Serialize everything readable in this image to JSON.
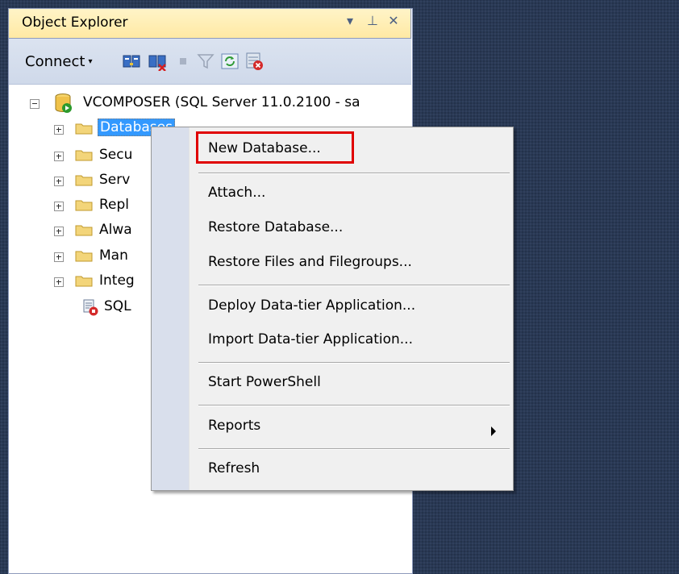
{
  "panel": {
    "title": "Object Explorer",
    "controls": {
      "dropdown": "▾",
      "pin": "⊥",
      "close": "✕"
    }
  },
  "toolbar": {
    "connect_label": "Connect",
    "connect_caret": "▾",
    "icons": [
      "connect-object-explorer-icon",
      "disconnect-icon",
      "stop-icon",
      "filter-icon",
      "refresh-icon",
      "activity-monitor-icon"
    ]
  },
  "tree": {
    "server": {
      "label": "VCOMPOSER (SQL Server 11.0.2100 - sa"
    },
    "children": [
      {
        "label": "Databases",
        "selected": true
      },
      {
        "label": "Secu"
      },
      {
        "label": "Serv"
      },
      {
        "label": "Repl"
      },
      {
        "label": "Alwa"
      },
      {
        "label": "Man"
      },
      {
        "label": "Integ"
      },
      {
        "label": "SQL"
      }
    ]
  },
  "context_menu": {
    "items": [
      {
        "label": "New Database..."
      },
      {
        "label": "Attach..."
      },
      {
        "label": "Restore Database..."
      },
      {
        "label": "Restore Files and Filegroups..."
      },
      {
        "label": "Deploy Data-tier Application..."
      },
      {
        "label": "Import Data-tier Application..."
      },
      {
        "label": "Start PowerShell"
      },
      {
        "label": "Reports",
        "has_submenu": true
      },
      {
        "label": "Refresh"
      }
    ],
    "highlight_color": "#e00000"
  },
  "colors": {
    "background": "#293955",
    "selection": "#3399ff",
    "titlebar": "#ffe9a4"
  }
}
